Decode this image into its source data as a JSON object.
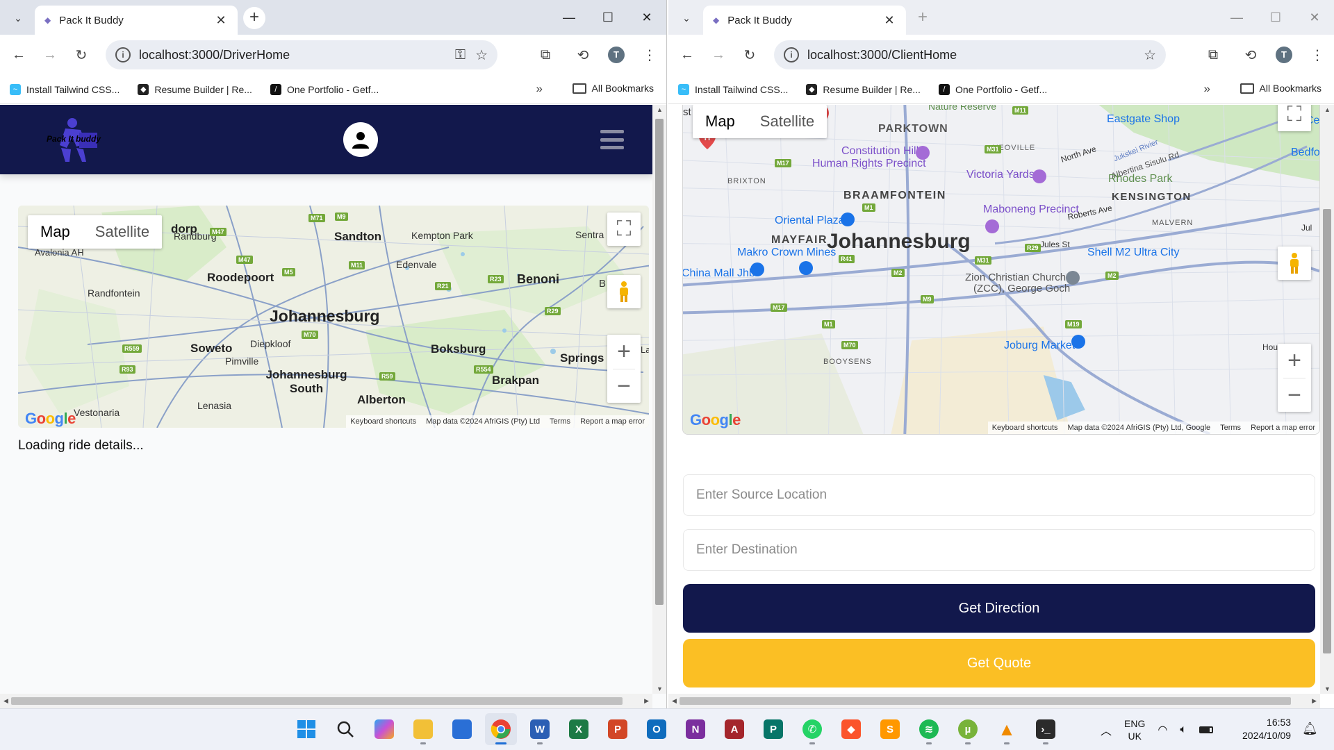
{
  "left_window": {
    "tab_title": "Pack It Buddy",
    "url": "localhost:3000/DriverHome",
    "bookmarks": [
      {
        "label": "Install Tailwind CSS...",
        "icon": "tailwind-icon"
      },
      {
        "label": "Resume Builder | Re...",
        "icon": "resume-icon"
      },
      {
        "label": "One Portfolio - Getf...",
        "icon": "portfolio-icon"
      }
    ],
    "all_bookmarks": "All Bookmarks",
    "avatar_letter": "T",
    "app": {
      "logo_text": "Pack It buddy",
      "map": {
        "map_label": "Map",
        "satellite_label": "Satellite",
        "labels": [
          "Randburg",
          "Sandton",
          "Kempton Park",
          "Sentra",
          "Avalonia AH",
          "Roodepoort",
          "Edenvale",
          "Benoni",
          "Randfontein",
          "Johannesburg",
          "Soweto",
          "Diepkloof",
          "Pimville",
          "Boksburg",
          "Springs",
          "Johannesburg South",
          "Brakpan",
          "Alberton",
          "Lenasia",
          "Vestonaria",
          "dorp",
          "B",
          "La"
        ],
        "attribution": [
          "Keyboard shortcuts",
          "Map data ©2024 AfriGIS (Pty) Ltd",
          "Terms",
          "Report a map error"
        ]
      },
      "loading_text": "Loading ride details..."
    }
  },
  "right_window": {
    "tab_title": "Pack It Buddy",
    "url": "localhost:3000/ClientHome",
    "bookmarks": [
      {
        "label": "Install Tailwind CSS...",
        "icon": "tailwind-icon"
      },
      {
        "label": "Resume Builder | Re...",
        "icon": "resume-icon"
      },
      {
        "label": "One Portfolio - Getf...",
        "icon": "portfolio-icon"
      }
    ],
    "all_bookmarks": "All Bookmarks",
    "avatar_letter": "T",
    "app": {
      "map": {
        "map_label": "Map",
        "satellite_label": "Satellite",
        "labels": [
          "PARKTOWN",
          "YEOVILLE",
          "Eastgate Shop",
          "Constitution Hill",
          "Human Rights Precinct",
          "North Ave",
          "Jukskei Rivier",
          "Albertina Sisulu Rd",
          "Bedfo",
          "BRIXTON",
          "Victoria Yards",
          "BRAAMFONTEIN",
          "Rhodes Park",
          "KENSINGTON",
          "Maboneng Precinct",
          "Roberts Ave",
          "MALVERN",
          "Oriental Plaza",
          "MAYFAIR",
          "Johannesburg",
          "Jules St",
          "Makro Crown Mines",
          "Shell M2 Ultra City",
          "China Mall Jhb",
          "Zion Christian Church",
          "(ZCC), George Goch",
          "Joburg Market",
          "BOOYSENS",
          "Hou",
          "Nature Reserve",
          "st",
          "Jul",
          "Ce"
        ],
        "attribution": [
          "Keyboard shortcuts",
          "Map data ©2024 AfriGIS (Pty) Ltd, Google",
          "Terms",
          "Report a map error"
        ]
      },
      "source_placeholder": "Enter Source Location",
      "destination_placeholder": "Enter Destination",
      "get_direction_label": "Get Direction",
      "get_quote_label": "Get Quote"
    }
  },
  "taskbar": {
    "apps": [
      "windows-start",
      "search",
      "copilot",
      "file-explorer",
      "microsoft-store",
      "chrome",
      "word",
      "excel",
      "powerpoint",
      "outlook",
      "onenote",
      "access",
      "publisher",
      "whatsapp",
      "brave",
      "sublime-text",
      "spotify",
      "utorrent",
      "vlc",
      "terminal"
    ],
    "language_top": "ENG",
    "language_bottom": "UK",
    "time": "16:53",
    "date": "2024/10/09"
  },
  "colors": {
    "nav_bg": "#12184c",
    "quote_bg": "#fbbf24",
    "chrome_tabstrip": "#dfe3eb"
  }
}
